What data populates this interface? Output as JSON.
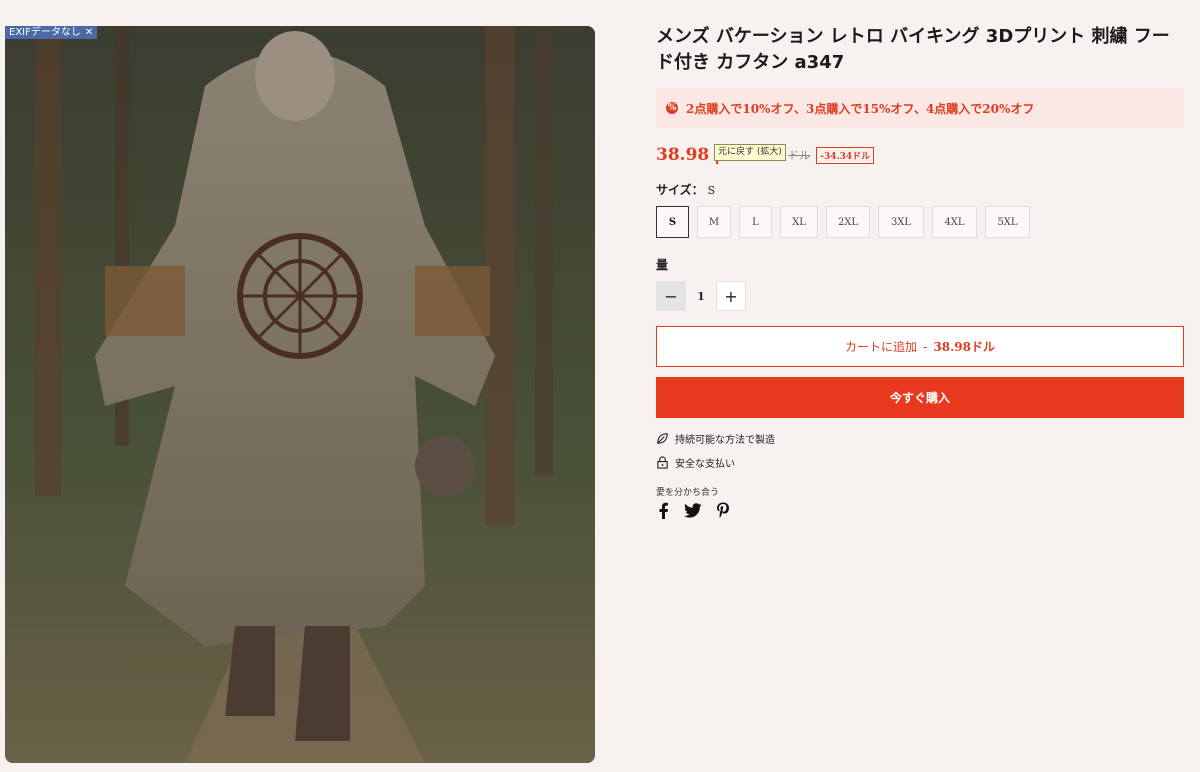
{
  "exif": {
    "label": "EXIFデータなし",
    "close": "✕"
  },
  "product": {
    "title": "メンズ バケーション レトロ バイキング 3Dプリント 刺繍 フード付き カフタン a347",
    "promo": "2点購入で10%オフ、3点購入で15%オフ、4点購入で20%オフ",
    "price": "38.98",
    "price_suffix": "ド",
    "tooltip": "元に戻す (拡大)",
    "old_price": "ドル",
    "save": "-34.34ドル"
  },
  "size": {
    "label": "サイズ：",
    "selected": "S",
    "options": [
      "S",
      "M",
      "L",
      "XL",
      "2XL",
      "3XL",
      "4XL",
      "5XL"
    ]
  },
  "quantity": {
    "label": "量",
    "minus": "−",
    "value": "1",
    "plus": "+"
  },
  "buttons": {
    "cart_label": "カートに追加",
    "cart_sep": "-",
    "cart_amount": "38.98ドル",
    "buy_label": "今すぐ購入"
  },
  "features": [
    {
      "icon": "leaf-icon",
      "text": "持続可能な方法で製造"
    },
    {
      "icon": "lock-icon",
      "text": "安全な支払い"
    }
  ],
  "share": {
    "label": "愛を分かち合う",
    "icons": [
      "facebook-icon",
      "twitter-icon",
      "pinterest-icon"
    ]
  },
  "colors": {
    "accent": "#e8391e",
    "promo_bg": "#fbe8e5",
    "page_bg": "#f7f1f0"
  }
}
